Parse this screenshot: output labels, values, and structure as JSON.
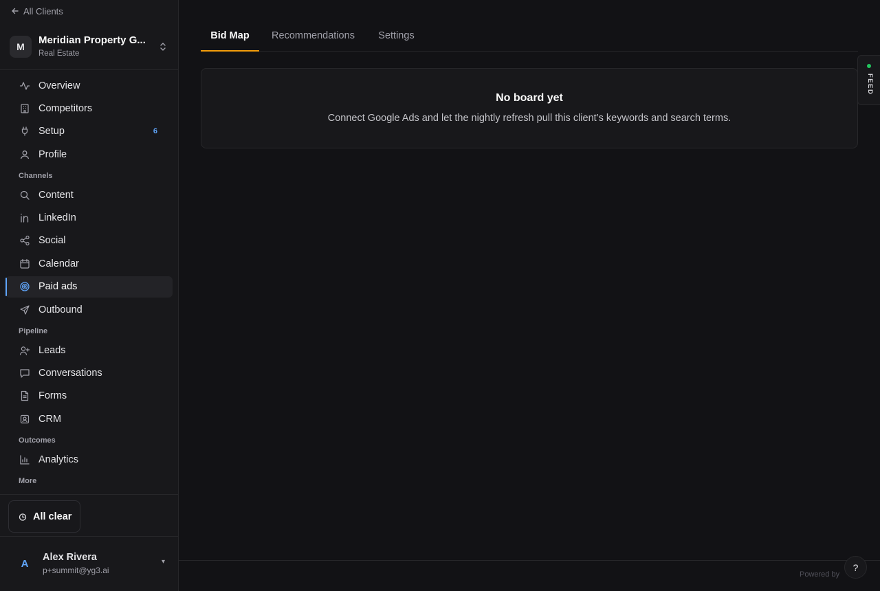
{
  "sidebar": {
    "back_label": "All Clients",
    "client": {
      "initial": "M",
      "name": "Meridian Property G...",
      "subtitle": "Real Estate"
    },
    "items_top": [
      {
        "label": "Overview",
        "icon": "activity-icon"
      },
      {
        "label": "Competitors",
        "icon": "building-icon"
      },
      {
        "label": "Setup",
        "icon": "plug-icon",
        "badge": "6"
      },
      {
        "label": "Profile",
        "icon": "user-icon"
      }
    ],
    "section_channels": "Channels",
    "items_channels": [
      {
        "label": "Content",
        "icon": "search-icon"
      },
      {
        "label": "LinkedIn",
        "icon": "linkedin-icon"
      },
      {
        "label": "Social",
        "icon": "share-icon"
      },
      {
        "label": "Calendar",
        "icon": "calendar-icon"
      },
      {
        "label": "Paid ads",
        "icon": "target-icon",
        "active": true
      },
      {
        "label": "Outbound",
        "icon": "send-icon"
      }
    ],
    "section_pipeline": "Pipeline",
    "items_pipeline": [
      {
        "label": "Leads",
        "icon": "user-plus-icon"
      },
      {
        "label": "Conversations",
        "icon": "message-icon"
      },
      {
        "label": "Forms",
        "icon": "file-text-icon"
      },
      {
        "label": "CRM",
        "icon": "contact-icon"
      }
    ],
    "section_outcomes": "Outcomes",
    "items_outcomes": [
      {
        "label": "Analytics",
        "icon": "bar-chart-icon"
      }
    ],
    "section_more": "More",
    "status_button": "All clear",
    "user": {
      "initial": "A",
      "name": "Alex Rivera",
      "email": "p+summit@yg3.ai"
    }
  },
  "tabs": [
    {
      "label": "Bid Map",
      "active": true
    },
    {
      "label": "Recommendations"
    },
    {
      "label": "Settings"
    }
  ],
  "empty_state": {
    "title": "No board yet",
    "description": "Connect Google Ads and let the nightly refresh pull this client’s keywords and search terms."
  },
  "feed_label": "FEED",
  "footer": {
    "powered_by": "Powered by"
  },
  "help_label": "?",
  "colors": {
    "accent": "#60a5fa",
    "tab_underline": "#f59e0b",
    "feed_dot": "#22c55e"
  }
}
